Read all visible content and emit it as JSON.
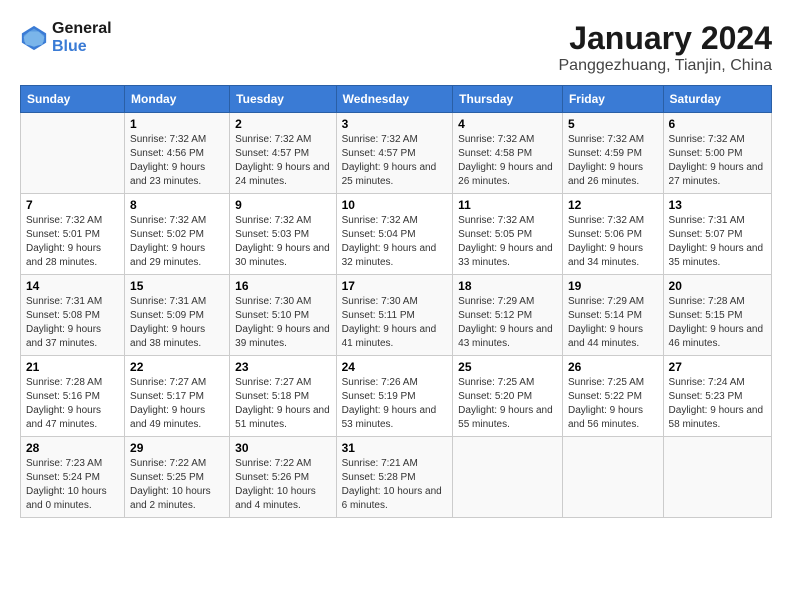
{
  "header": {
    "logo_line1": "General",
    "logo_line2": "Blue",
    "month_year": "January 2024",
    "location": "Panggezhuang, Tianjin, China"
  },
  "weekdays": [
    "Sunday",
    "Monday",
    "Tuesday",
    "Wednesday",
    "Thursday",
    "Friday",
    "Saturday"
  ],
  "weeks": [
    [
      {
        "day": "",
        "sunrise": "",
        "sunset": "",
        "daylight": ""
      },
      {
        "day": "1",
        "sunrise": "Sunrise: 7:32 AM",
        "sunset": "Sunset: 4:56 PM",
        "daylight": "Daylight: 9 hours and 23 minutes."
      },
      {
        "day": "2",
        "sunrise": "Sunrise: 7:32 AM",
        "sunset": "Sunset: 4:57 PM",
        "daylight": "Daylight: 9 hours and 24 minutes."
      },
      {
        "day": "3",
        "sunrise": "Sunrise: 7:32 AM",
        "sunset": "Sunset: 4:57 PM",
        "daylight": "Daylight: 9 hours and 25 minutes."
      },
      {
        "day": "4",
        "sunrise": "Sunrise: 7:32 AM",
        "sunset": "Sunset: 4:58 PM",
        "daylight": "Daylight: 9 hours and 26 minutes."
      },
      {
        "day": "5",
        "sunrise": "Sunrise: 7:32 AM",
        "sunset": "Sunset: 4:59 PM",
        "daylight": "Daylight: 9 hours and 26 minutes."
      },
      {
        "day": "6",
        "sunrise": "Sunrise: 7:32 AM",
        "sunset": "Sunset: 5:00 PM",
        "daylight": "Daylight: 9 hours and 27 minutes."
      }
    ],
    [
      {
        "day": "7",
        "sunrise": "Sunrise: 7:32 AM",
        "sunset": "Sunset: 5:01 PM",
        "daylight": "Daylight: 9 hours and 28 minutes."
      },
      {
        "day": "8",
        "sunrise": "Sunrise: 7:32 AM",
        "sunset": "Sunset: 5:02 PM",
        "daylight": "Daylight: 9 hours and 29 minutes."
      },
      {
        "day": "9",
        "sunrise": "Sunrise: 7:32 AM",
        "sunset": "Sunset: 5:03 PM",
        "daylight": "Daylight: 9 hours and 30 minutes."
      },
      {
        "day": "10",
        "sunrise": "Sunrise: 7:32 AM",
        "sunset": "Sunset: 5:04 PM",
        "daylight": "Daylight: 9 hours and 32 minutes."
      },
      {
        "day": "11",
        "sunrise": "Sunrise: 7:32 AM",
        "sunset": "Sunset: 5:05 PM",
        "daylight": "Daylight: 9 hours and 33 minutes."
      },
      {
        "day": "12",
        "sunrise": "Sunrise: 7:32 AM",
        "sunset": "Sunset: 5:06 PM",
        "daylight": "Daylight: 9 hours and 34 minutes."
      },
      {
        "day": "13",
        "sunrise": "Sunrise: 7:31 AM",
        "sunset": "Sunset: 5:07 PM",
        "daylight": "Daylight: 9 hours and 35 minutes."
      }
    ],
    [
      {
        "day": "14",
        "sunrise": "Sunrise: 7:31 AM",
        "sunset": "Sunset: 5:08 PM",
        "daylight": "Daylight: 9 hours and 37 minutes."
      },
      {
        "day": "15",
        "sunrise": "Sunrise: 7:31 AM",
        "sunset": "Sunset: 5:09 PM",
        "daylight": "Daylight: 9 hours and 38 minutes."
      },
      {
        "day": "16",
        "sunrise": "Sunrise: 7:30 AM",
        "sunset": "Sunset: 5:10 PM",
        "daylight": "Daylight: 9 hours and 39 minutes."
      },
      {
        "day": "17",
        "sunrise": "Sunrise: 7:30 AM",
        "sunset": "Sunset: 5:11 PM",
        "daylight": "Daylight: 9 hours and 41 minutes."
      },
      {
        "day": "18",
        "sunrise": "Sunrise: 7:29 AM",
        "sunset": "Sunset: 5:12 PM",
        "daylight": "Daylight: 9 hours and 43 minutes."
      },
      {
        "day": "19",
        "sunrise": "Sunrise: 7:29 AM",
        "sunset": "Sunset: 5:14 PM",
        "daylight": "Daylight: 9 hours and 44 minutes."
      },
      {
        "day": "20",
        "sunrise": "Sunrise: 7:28 AM",
        "sunset": "Sunset: 5:15 PM",
        "daylight": "Daylight: 9 hours and 46 minutes."
      }
    ],
    [
      {
        "day": "21",
        "sunrise": "Sunrise: 7:28 AM",
        "sunset": "Sunset: 5:16 PM",
        "daylight": "Daylight: 9 hours and 47 minutes."
      },
      {
        "day": "22",
        "sunrise": "Sunrise: 7:27 AM",
        "sunset": "Sunset: 5:17 PM",
        "daylight": "Daylight: 9 hours and 49 minutes."
      },
      {
        "day": "23",
        "sunrise": "Sunrise: 7:27 AM",
        "sunset": "Sunset: 5:18 PM",
        "daylight": "Daylight: 9 hours and 51 minutes."
      },
      {
        "day": "24",
        "sunrise": "Sunrise: 7:26 AM",
        "sunset": "Sunset: 5:19 PM",
        "daylight": "Daylight: 9 hours and 53 minutes."
      },
      {
        "day": "25",
        "sunrise": "Sunrise: 7:25 AM",
        "sunset": "Sunset: 5:20 PM",
        "daylight": "Daylight: 9 hours and 55 minutes."
      },
      {
        "day": "26",
        "sunrise": "Sunrise: 7:25 AM",
        "sunset": "Sunset: 5:22 PM",
        "daylight": "Daylight: 9 hours and 56 minutes."
      },
      {
        "day": "27",
        "sunrise": "Sunrise: 7:24 AM",
        "sunset": "Sunset: 5:23 PM",
        "daylight": "Daylight: 9 hours and 58 minutes."
      }
    ],
    [
      {
        "day": "28",
        "sunrise": "Sunrise: 7:23 AM",
        "sunset": "Sunset: 5:24 PM",
        "daylight": "Daylight: 10 hours and 0 minutes."
      },
      {
        "day": "29",
        "sunrise": "Sunrise: 7:22 AM",
        "sunset": "Sunset: 5:25 PM",
        "daylight": "Daylight: 10 hours and 2 minutes."
      },
      {
        "day": "30",
        "sunrise": "Sunrise: 7:22 AM",
        "sunset": "Sunset: 5:26 PM",
        "daylight": "Daylight: 10 hours and 4 minutes."
      },
      {
        "day": "31",
        "sunrise": "Sunrise: 7:21 AM",
        "sunset": "Sunset: 5:28 PM",
        "daylight": "Daylight: 10 hours and 6 minutes."
      },
      {
        "day": "",
        "sunrise": "",
        "sunset": "",
        "daylight": ""
      },
      {
        "day": "",
        "sunrise": "",
        "sunset": "",
        "daylight": ""
      },
      {
        "day": "",
        "sunrise": "",
        "sunset": "",
        "daylight": ""
      }
    ]
  ]
}
